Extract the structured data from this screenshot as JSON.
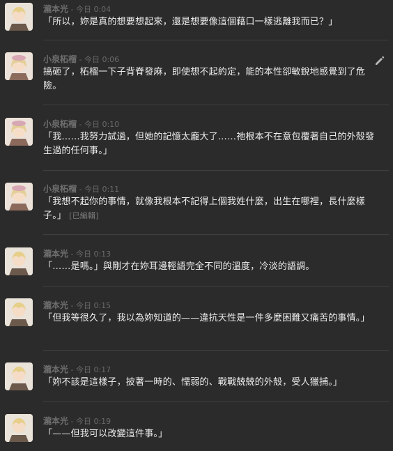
{
  "messages": [
    {
      "author": "瀧本光",
      "sep": " - ",
      "time": "今日 0:04",
      "text": "「所以，妳是真的想要想起來，還是想要像這個藉口一樣逃離我而已？」",
      "edited": ""
    },
    {
      "author": "小泉柘榴",
      "sep": " - ",
      "time": "今日 0:06",
      "text": "搞砸了，柘榴一下子背脊發麻，即使想不起約定，能的本性卻敏銳地感覺到了危險。",
      "edited": ""
    },
    {
      "author": "小泉柘榴",
      "sep": " - ",
      "time": "今日 0:10",
      "text": "「我……我努力試過，但她的記憶太龐大了……祂根本不在意包覆著自己的外殼發生過的任何事。」",
      "edited": ""
    },
    {
      "author": "小泉柘榴",
      "sep": " - ",
      "time": "今日 0:11",
      "text": "「我想不起你的事情，就像我根本不記得上個我姓什麼，出生在哪裡，長什麼樣子。」",
      "edited": "[已編輯]"
    },
    {
      "author": "瀧本光",
      "sep": " - ",
      "time": "今日 0:13",
      "text": "「……是嗎。」與剛才在妳耳邊輕語完全不同的溫度，冷淡的語調。",
      "edited": ""
    },
    {
      "author": "瀧本光",
      "sep": " - ",
      "time": "今日 0:15",
      "text": "「但我等很久了，我以為妳知道的——違抗天性是一件多麼困難又痛苦的事情。」",
      "edited": ""
    },
    {
      "author": "瀧本光",
      "sep": " - ",
      "time": "今日 0:17",
      "text": "「妳不該是這樣子，披著一時的、懦弱的、戰戰兢兢的外殼，受人獵捕。」",
      "edited": ""
    },
    {
      "author": "瀧本光",
      "sep": " - ",
      "time": "今日 0:19",
      "text": "「——但我可以改變這件事。」",
      "edited": ""
    }
  ],
  "icons": {
    "edit": "pencil-icon"
  },
  "colors": {
    "background": "#2b2b2b",
    "author": "#6f6f6f",
    "timestamp": "#6a6a6a",
    "text": "#ececec"
  }
}
